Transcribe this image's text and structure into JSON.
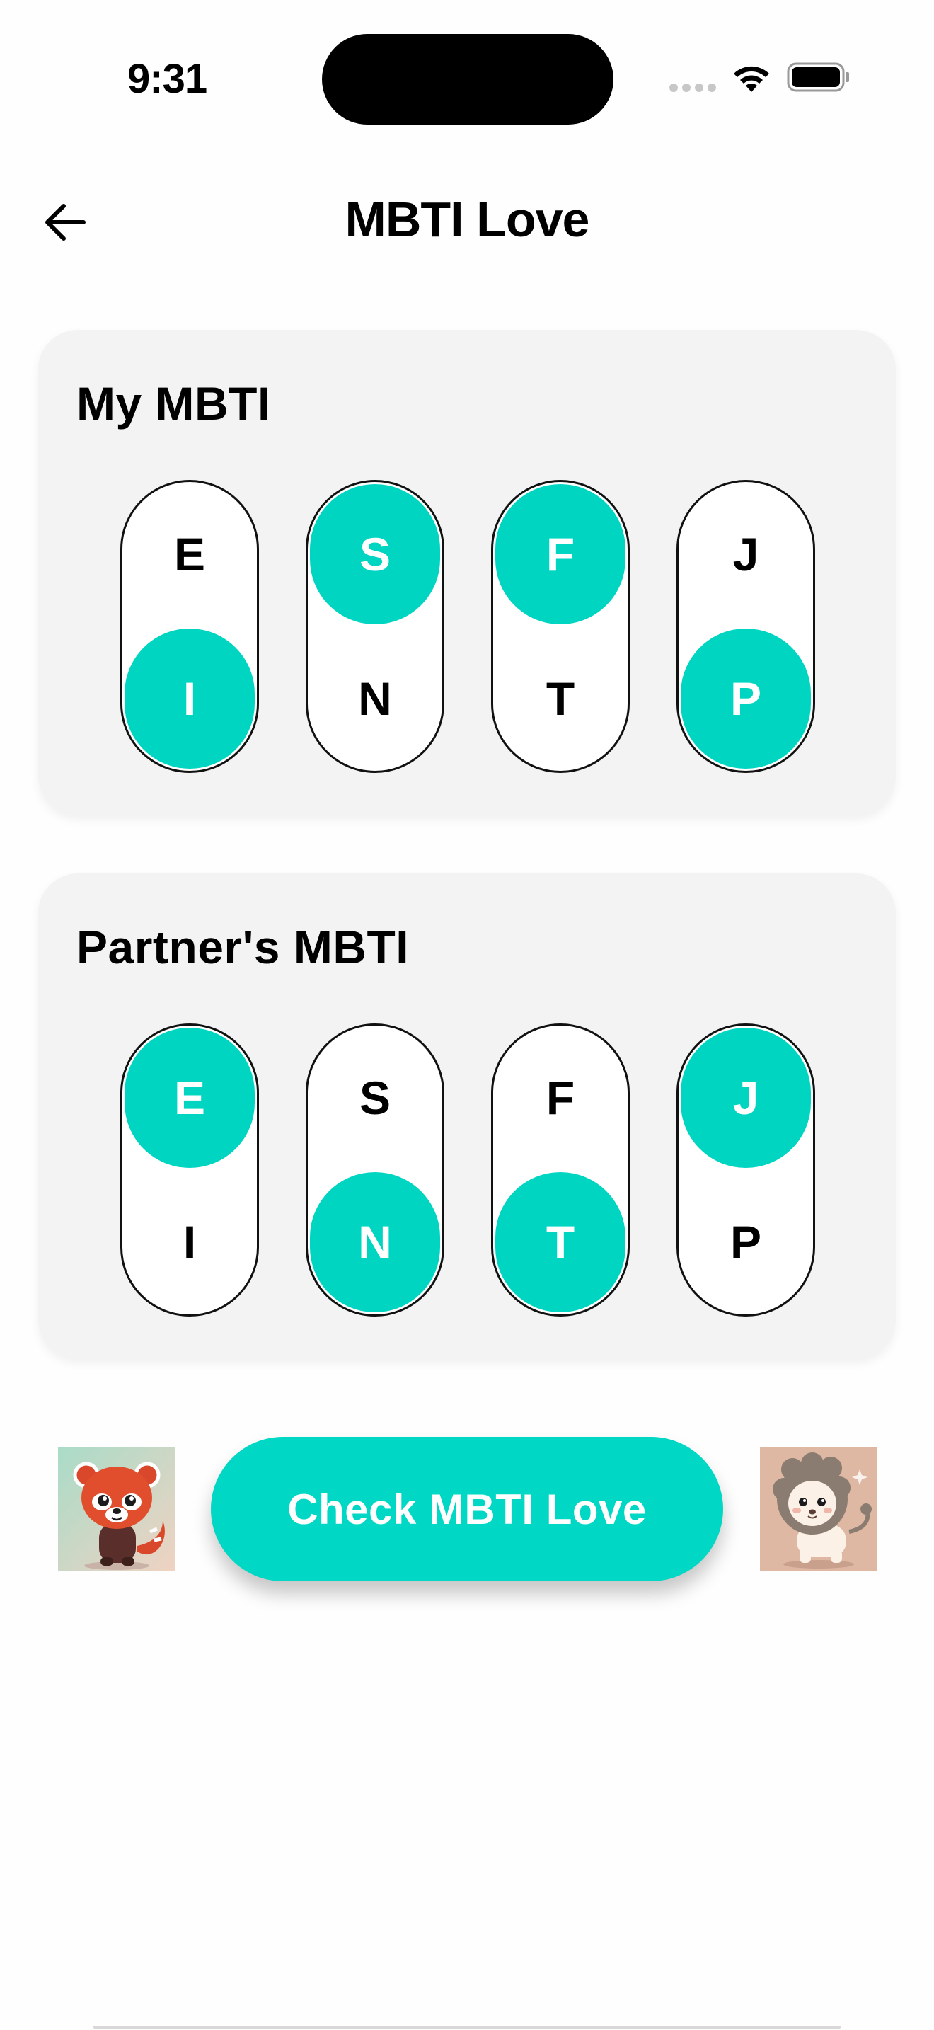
{
  "status_bar": {
    "time": "9:31"
  },
  "header": {
    "title": "MBTI Love",
    "back_icon": "arrow-left-icon"
  },
  "my_mbti": {
    "title": "My MBTI",
    "pairs": [
      {
        "top": "E",
        "bottom": "I",
        "selected": "bottom"
      },
      {
        "top": "S",
        "bottom": "N",
        "selected": "top"
      },
      {
        "top": "F",
        "bottom": "T",
        "selected": "top"
      },
      {
        "top": "J",
        "bottom": "P",
        "selected": "bottom"
      }
    ]
  },
  "partner_mbti": {
    "title": "Partner's MBTI",
    "pairs": [
      {
        "top": "E",
        "bottom": "I",
        "selected": "top"
      },
      {
        "top": "S",
        "bottom": "N",
        "selected": "bottom"
      },
      {
        "top": "F",
        "bottom": "T",
        "selected": "bottom"
      },
      {
        "top": "J",
        "bottom": "P",
        "selected": "top"
      }
    ]
  },
  "actions": {
    "check_label": "Check MBTI Love",
    "left_avatar": "red-panda-avatar",
    "right_avatar": "lion-avatar"
  },
  "colors": {
    "accent": "#00d5c2",
    "card_bg": "#f3f3f3"
  }
}
